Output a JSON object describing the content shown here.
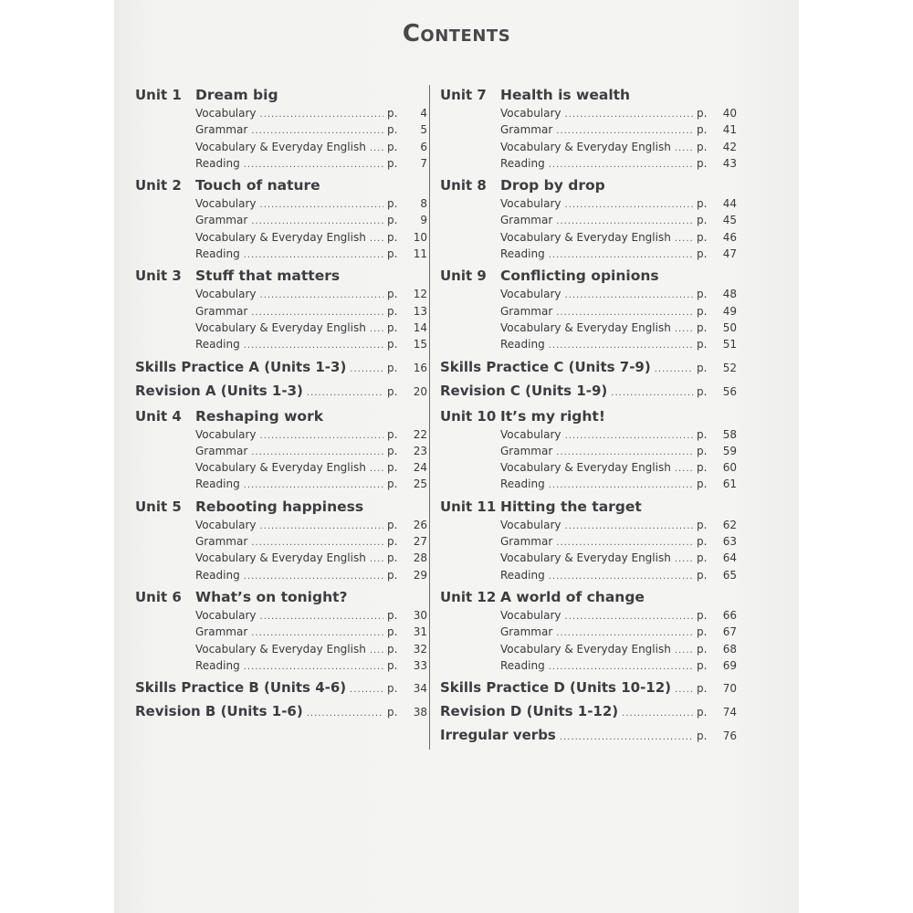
{
  "title": "Contents",
  "left_column": [
    {
      "type": "unit",
      "label": "Unit 1",
      "title": "Dream big",
      "items": [
        {
          "label": "Vocabulary",
          "page": "4"
        },
        {
          "label": "Grammar",
          "page": "5"
        },
        {
          "label": "Vocabulary & Everyday English",
          "page": "6"
        },
        {
          "label": "Reading",
          "page": "7"
        }
      ]
    },
    {
      "type": "unit",
      "label": "Unit 2",
      "title": "Touch of nature",
      "items": [
        {
          "label": "Vocabulary",
          "page": "8"
        },
        {
          "label": "Grammar",
          "page": "9"
        },
        {
          "label": "Vocabulary & Everyday English",
          "page": "10"
        },
        {
          "label": "Reading",
          "page": "11"
        }
      ]
    },
    {
      "type": "unit",
      "label": "Unit 3",
      "title": "Stuff that matters",
      "items": [
        {
          "label": "Vocabulary",
          "page": "12"
        },
        {
          "label": "Grammar",
          "page": "13"
        },
        {
          "label": "Vocabulary & Everyday English",
          "page": "14"
        },
        {
          "label": "Reading",
          "page": "15"
        }
      ]
    },
    {
      "type": "entry",
      "label": "Skills Practice A (Units 1-3)",
      "page": "16"
    },
    {
      "type": "entry",
      "label": "Revision A (Units 1-3)",
      "page": "20"
    },
    {
      "type": "unit",
      "label": "Unit 4",
      "title": "Reshaping work",
      "items": [
        {
          "label": "Vocabulary",
          "page": "22"
        },
        {
          "label": "Grammar",
          "page": "23"
        },
        {
          "label": "Vocabulary & Everyday English",
          "page": "24"
        },
        {
          "label": "Reading",
          "page": "25"
        }
      ]
    },
    {
      "type": "unit",
      "label": "Unit 5",
      "title": "Rebooting happiness",
      "items": [
        {
          "label": "Vocabulary",
          "page": "26"
        },
        {
          "label": "Grammar",
          "page": "27"
        },
        {
          "label": "Vocabulary & Everyday English",
          "page": "28"
        },
        {
          "label": "Reading",
          "page": "29"
        }
      ]
    },
    {
      "type": "unit",
      "label": "Unit 6",
      "title": "What’s on tonight?",
      "items": [
        {
          "label": "Vocabulary",
          "page": "30"
        },
        {
          "label": "Grammar",
          "page": "31"
        },
        {
          "label": "Vocabulary & Everyday English",
          "page": "32"
        },
        {
          "label": "Reading",
          "page": "33"
        }
      ]
    },
    {
      "type": "entry",
      "label": "Skills Practice B (Units 4-6)",
      "page": "34"
    },
    {
      "type": "entry",
      "label": "Revision B (Units 1-6)",
      "page": "38"
    }
  ],
  "right_column": [
    {
      "type": "unit",
      "label": "Unit 7",
      "title": "Health is wealth",
      "items": [
        {
          "label": "Vocabulary",
          "page": "40"
        },
        {
          "label": "Grammar",
          "page": "41"
        },
        {
          "label": "Vocabulary & Everyday English",
          "page": "42"
        },
        {
          "label": "Reading",
          "page": "43"
        }
      ]
    },
    {
      "type": "unit",
      "label": "Unit 8",
      "title": "Drop by drop",
      "items": [
        {
          "label": "Vocabulary",
          "page": "44"
        },
        {
          "label": "Grammar",
          "page": "45"
        },
        {
          "label": "Vocabulary & Everyday English",
          "page": "46"
        },
        {
          "label": "Reading",
          "page": "47"
        }
      ]
    },
    {
      "type": "unit",
      "label": "Unit 9",
      "title": "Conflicting opinions",
      "items": [
        {
          "label": "Vocabulary",
          "page": "48"
        },
        {
          "label": "Grammar",
          "page": "49"
        },
        {
          "label": "Vocabulary & Everyday English",
          "page": "50"
        },
        {
          "label": "Reading",
          "page": "51"
        }
      ]
    },
    {
      "type": "entry",
      "label": "Skills Practice C (Units 7-9)",
      "page": "52"
    },
    {
      "type": "entry",
      "label": "Revision C (Units 1-9)",
      "page": "56"
    },
    {
      "type": "unit",
      "label": "Unit 10",
      "title": "It’s my right!",
      "items": [
        {
          "label": "Vocabulary",
          "page": "58"
        },
        {
          "label": "Grammar",
          "page": "59"
        },
        {
          "label": "Vocabulary & Everyday English",
          "page": "60"
        },
        {
          "label": "Reading",
          "page": "61"
        }
      ]
    },
    {
      "type": "unit",
      "label": "Unit 11",
      "title": "Hitting the target",
      "items": [
        {
          "label": "Vocabulary",
          "page": "62"
        },
        {
          "label": "Grammar",
          "page": "63"
        },
        {
          "label": "Vocabulary & Everyday English",
          "page": "64"
        },
        {
          "label": "Reading",
          "page": "65"
        }
      ]
    },
    {
      "type": "unit",
      "label": "Unit 12",
      "title": "A world of change",
      "items": [
        {
          "label": "Vocabulary",
          "page": "66"
        },
        {
          "label": "Grammar",
          "page": "67"
        },
        {
          "label": "Vocabulary & Everyday English",
          "page": "68"
        },
        {
          "label": "Reading",
          "page": "69"
        }
      ]
    },
    {
      "type": "entry",
      "label": "Skills Practice D (Units 10-12)",
      "page": "70"
    },
    {
      "type": "entry",
      "label": "Revision D (Units 1-12)",
      "page": "74"
    },
    {
      "type": "entry",
      "label": "Irregular verbs",
      "page": "76"
    }
  ],
  "page_prefix": "p."
}
